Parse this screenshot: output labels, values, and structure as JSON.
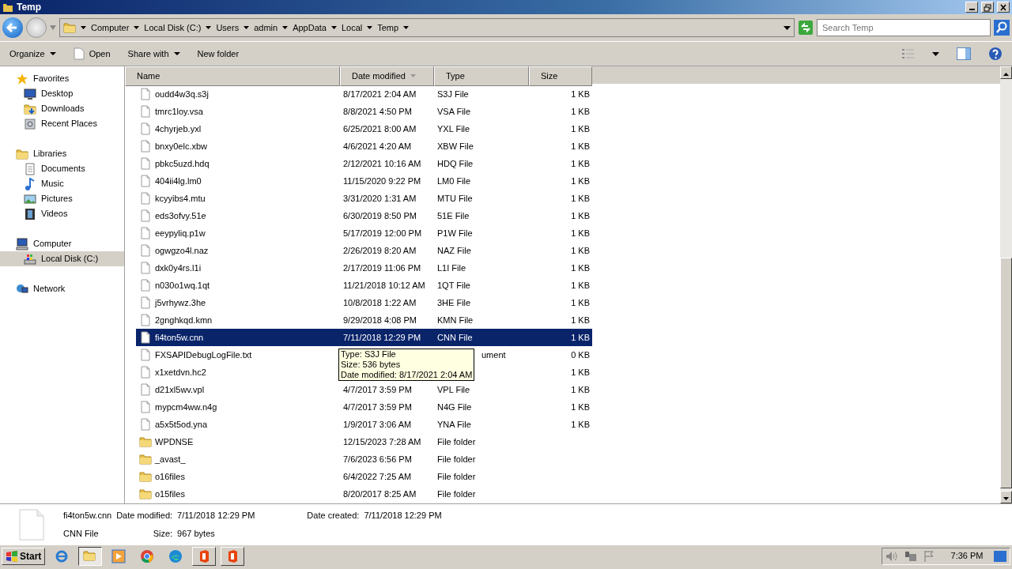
{
  "window": {
    "title": "Temp"
  },
  "address": {
    "crumbs": [
      "Computer",
      "Local Disk (C:)",
      "Users",
      "admin",
      "AppData",
      "Local",
      "Temp"
    ]
  },
  "search": {
    "placeholder": "Search Temp"
  },
  "toolbar": [
    {
      "label": "Organize",
      "kind": "menu"
    },
    {
      "label": "Open",
      "kind": "open"
    },
    {
      "label": "Share with",
      "kind": "menu"
    },
    {
      "label": "New folder",
      "kind": "plain"
    }
  ],
  "sidebar": {
    "groups": [
      {
        "label": "Favorites",
        "selected": false,
        "children": [
          {
            "label": "Desktop",
            "selected": false
          },
          {
            "label": "Downloads",
            "selected": false
          },
          {
            "label": "Recent Places",
            "selected": false
          }
        ]
      },
      {
        "label": "Libraries",
        "selected": false,
        "children": [
          {
            "label": "Documents",
            "selected": false
          },
          {
            "label": "Music",
            "selected": false
          },
          {
            "label": "Pictures",
            "selected": false
          },
          {
            "label": "Videos",
            "selected": false
          }
        ]
      },
      {
        "label": "Computer",
        "selected": false,
        "children": [
          {
            "label": "Local Disk (C:)",
            "selected": true
          }
        ]
      },
      {
        "label": "Network",
        "selected": false
      }
    ]
  },
  "table": {
    "columns": [
      {
        "label": "Name",
        "sorted": false
      },
      {
        "label": "Date modified",
        "sorted": true
      },
      {
        "label": "Type",
        "sorted": false
      },
      {
        "label": "Size",
        "sorted": false
      }
    ],
    "rows": [
      {
        "name": "oudd4w3q.s3j",
        "date": "8/17/2021 2:04 AM",
        "type": "S3J File",
        "size": "1 KB",
        "kind": "file",
        "selected": false
      },
      {
        "name": "tmrc1loy.vsa",
        "date": "8/8/2021 4:50 PM",
        "type": "VSA File",
        "size": "1 KB",
        "kind": "file",
        "selected": false
      },
      {
        "name": "4chyrjeb.yxl",
        "date": "6/25/2021 8:00 AM",
        "type": "YXL File",
        "size": "1 KB",
        "kind": "file",
        "selected": false
      },
      {
        "name": "bnxy0elc.xbw",
        "date": "4/6/2021 4:20 AM",
        "type": "XBW File",
        "size": "1 KB",
        "kind": "file",
        "selected": false
      },
      {
        "name": "pbkc5uzd.hdq",
        "date": "2/12/2021 10:16 AM",
        "type": "HDQ File",
        "size": "1 KB",
        "kind": "file",
        "selected": false
      },
      {
        "name": "404ii4lg.lm0",
        "date": "11/15/2020 9:22 PM",
        "type": "LM0 File",
        "size": "1 KB",
        "kind": "file",
        "selected": false
      },
      {
        "name": "kcyyibs4.mtu",
        "date": "3/31/2020 1:31 AM",
        "type": "MTU File",
        "size": "1 KB",
        "kind": "file",
        "selected": false
      },
      {
        "name": "eds3ofvy.51e",
        "date": "6/30/2019 8:50 PM",
        "type": "51E File",
        "size": "1 KB",
        "kind": "file",
        "selected": false
      },
      {
        "name": "eeypyliq.p1w",
        "date": "5/17/2019 12:00 PM",
        "type": "P1W File",
        "size": "1 KB",
        "kind": "file",
        "selected": false
      },
      {
        "name": "ogwgzo4l.naz",
        "date": "2/26/2019 8:20 AM",
        "type": "NAZ File",
        "size": "1 KB",
        "kind": "file",
        "selected": false
      },
      {
        "name": "dxk0y4rs.l1i",
        "date": "2/17/2019 11:06 PM",
        "type": "L1I File",
        "size": "1 KB",
        "kind": "file",
        "selected": false
      },
      {
        "name": "n030o1wq.1qt",
        "date": "11/21/2018 10:12 AM",
        "type": "1QT File",
        "size": "1 KB",
        "kind": "file",
        "selected": false
      },
      {
        "name": "j5vrhywz.3he",
        "date": "10/8/2018 1:22 AM",
        "type": "3HE File",
        "size": "1 KB",
        "kind": "file",
        "selected": false
      },
      {
        "name": "2gnghkqd.kmn",
        "date": "9/29/2018 4:08 PM",
        "type": "KMN File",
        "size": "1 KB",
        "kind": "file",
        "selected": false
      },
      {
        "name": "fi4ton5w.cnn",
        "date": "7/11/2018 12:29 PM",
        "type": "CNN File",
        "size": "1 KB",
        "kind": "file",
        "selected": true
      },
      {
        "name": "FXSAPIDebugLogFile.txt",
        "type": "ument",
        "size": "0 KB",
        "kind": "file",
        "selected": false
      },
      {
        "name": "x1xetdvn.hc2",
        "size": "1 KB",
        "kind": "file",
        "selected": false
      },
      {
        "name": "d21xl5wv.vpl",
        "date": "4/7/2017 3:59 PM",
        "type": "VPL File",
        "size": "1 KB",
        "kind": "file",
        "selected": false
      },
      {
        "name": "mypcm4ww.n4g",
        "date": "4/7/2017 3:59 PM",
        "type": "N4G File",
        "size": "1 KB",
        "kind": "file",
        "selected": false
      },
      {
        "name": "a5x5t5od.yna",
        "date": "1/9/2017 3:06 AM",
        "type": "YNA File",
        "size": "1 KB",
        "kind": "file",
        "selected": false
      },
      {
        "name": "WPDNSE",
        "date": "12/15/2023 7:28 AM",
        "type": "File folder",
        "kind": "folder",
        "selected": false
      },
      {
        "name": "_avast_",
        "date": "7/6/2023 6:56 PM",
        "type": "File folder",
        "kind": "folder",
        "selected": false
      },
      {
        "name": "o16files",
        "date": "6/4/2022 7:25 AM",
        "type": "File folder",
        "kind": "folder",
        "selected": false
      },
      {
        "name": "o15files",
        "date": "8/20/2017 8:25 AM",
        "type": "File folder",
        "kind": "folder",
        "selected": false
      }
    ]
  },
  "tooltip": {
    "lines": [
      "Type: S3J File",
      "Size: 536 bytes",
      "Date modified: 8/17/2021 2:04 AM"
    ]
  },
  "details": {
    "name": "fi4ton5w.cnn",
    "type": "CNN File",
    "fields": [
      {
        "label": "Date modified:",
        "value": "7/11/2018 12:29 PM"
      },
      {
        "label": "Date created:",
        "value": "7/11/2018 12:29 PM"
      },
      {
        "label": "Size:",
        "value": "967 bytes"
      }
    ]
  },
  "taskbar": {
    "start": "Start",
    "apps": [
      {
        "active": false
      },
      {
        "active": true
      },
      {
        "active": false
      },
      {
        "active": false
      },
      {
        "active": false
      },
      {
        "active": false
      },
      {
        "active": false
      }
    ],
    "clock": "7:36 PM"
  }
}
